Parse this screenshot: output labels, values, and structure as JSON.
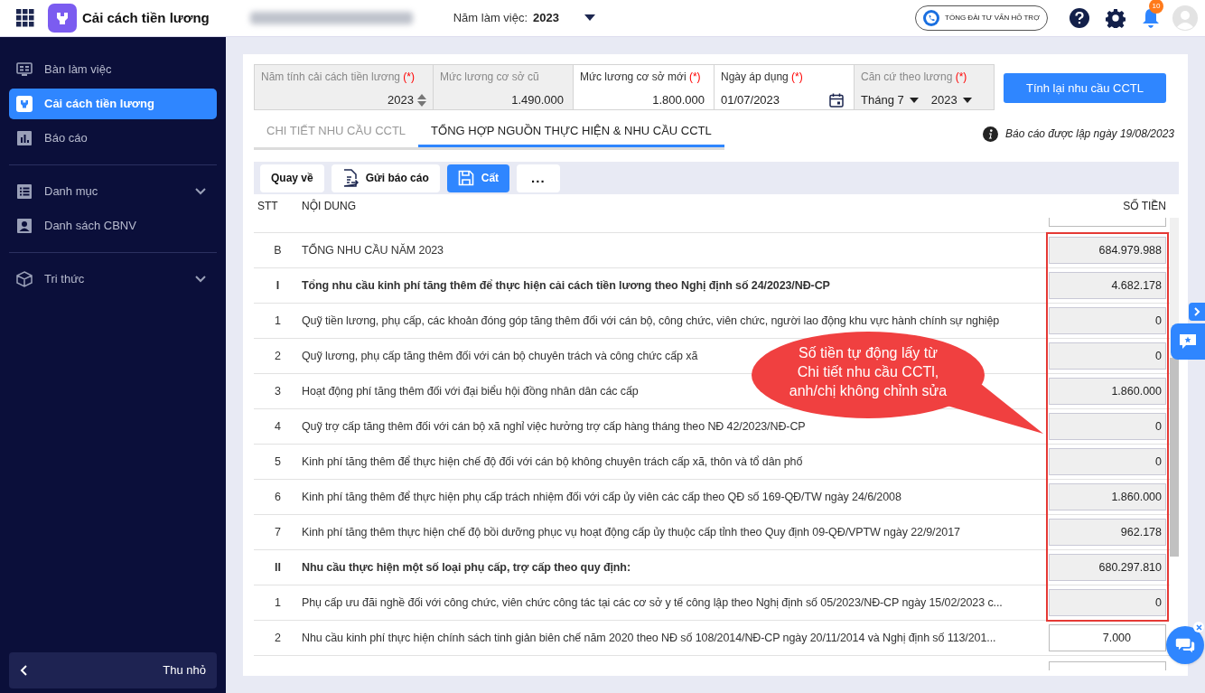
{
  "header": {
    "app_title": "Cải cách tiền lương",
    "year_label": "Năm làm việc:",
    "year": "2023",
    "hotline": "TỔNG ĐÀI TƯ VẤN HỖ TRỢ",
    "notification_count": "10"
  },
  "sidebar": {
    "sections": [
      [
        {
          "label": "Bàn làm việc",
          "selected": false,
          "has_submenu": false
        },
        {
          "label": "Cải cách tiền lương",
          "selected": true,
          "has_submenu": false
        },
        {
          "label": "Báo cáo",
          "selected": false,
          "has_submenu": false
        }
      ],
      [
        {
          "label": "Danh mục",
          "selected": false,
          "has_submenu": true
        },
        {
          "label": "Danh sách CBNV",
          "selected": false,
          "has_submenu": false
        }
      ],
      [
        {
          "label": "Tri thức",
          "selected": false,
          "has_submenu": true
        }
      ]
    ],
    "collapse_label": "Thu nhỏ"
  },
  "form": {
    "fields": [
      {
        "label": "Năm tính cải cách tiền lương",
        "required_mark": "(*)",
        "kind": "spinner",
        "disabled": true,
        "values": [
          "2023"
        ]
      },
      {
        "label": "Mức lương cơ sở cũ",
        "kind": "text",
        "disabled": true,
        "values": [
          "1.490.000"
        ]
      },
      {
        "label": "Mức lương cơ sở mới",
        "required_mark": "(*)",
        "kind": "text",
        "disabled": false,
        "values": [
          "1.800.000"
        ]
      },
      {
        "label": "Ngày áp dụng",
        "required_mark": "(*)",
        "kind": "date",
        "disabled": false,
        "values": [
          "01/07/2023"
        ]
      },
      {
        "label": "Căn cứ theo lương",
        "required_mark": "(*)",
        "kind": "selects",
        "disabled": true,
        "values": [
          "Tháng 7",
          "2023"
        ]
      }
    ],
    "button": "Tính lại nhu cầu CCTL"
  },
  "tabs": [
    {
      "label": "CHI TIẾT NHU CẦU CCTL",
      "selected": false
    },
    {
      "label": "TỔNG HỢP NGUỒN THỰC HIỆN & NHU CẦU CCTL",
      "selected": true
    }
  ],
  "report_note": "Báo cáo được lập ngày 19/08/2023",
  "toolbar": [
    {
      "label": "Quay về",
      "kind": "plain"
    },
    {
      "label": "Gửi báo cáo",
      "kind": "send"
    },
    {
      "label": "Cất",
      "kind": "save"
    },
    {
      "label": "...",
      "kind": "more"
    }
  ],
  "table": {
    "columns": [
      "STT",
      "NỘI DUNG",
      "SỐ TIỀN"
    ],
    "rows": [
      {
        "stt": "B",
        "content": "TỔNG NHU CẦU NĂM 2023",
        "amount": "684.979.988",
        "bold": false,
        "readonly": true
      },
      {
        "stt": "I",
        "content": "Tổng nhu cầu kinh phí tăng thêm để thực hiện cải cách tiền lương theo Nghị định số 24/2023/NĐ-CP",
        "amount": "4.682.178",
        "bold": true,
        "readonly": true
      },
      {
        "stt": "1",
        "content": "Quỹ tiền lương, phụ cấp, các khoản đóng góp tăng thêm đối với cán bộ, công chức, viên chức, người lao động khu vực hành chính sự nghiệp",
        "amount": "0",
        "bold": false,
        "readonly": true
      },
      {
        "stt": "2",
        "content": "Quỹ lương, phụ cấp tăng thêm đối với cán bộ chuyên trách và công chức cấp xã",
        "amount": "0",
        "bold": false,
        "readonly": true
      },
      {
        "stt": "3",
        "content": "Hoạt động phí tăng thêm đối với đại biểu hội đồng nhân dân các cấp",
        "amount": "1.860.000",
        "bold": false,
        "readonly": true
      },
      {
        "stt": "4",
        "content": "Quỹ trợ cấp tăng thêm đối với cán bộ xã nghỉ việc hưởng trợ cấp hàng tháng theo NĐ 42/2023/NĐ-CP",
        "amount": "0",
        "bold": false,
        "readonly": true
      },
      {
        "stt": "5",
        "content": "Kinh phí tăng thêm để thực hiện chế độ đối với cán bộ không chuyên trách cấp xã, thôn và tổ dân phố",
        "amount": "0",
        "bold": false,
        "readonly": true
      },
      {
        "stt": "6",
        "content": "Kinh phí tăng thêm để thực hiện phụ cấp trách nhiệm đối với cấp ủy viên các cấp theo QĐ số 169-QĐ/TW ngày 24/6/2008",
        "amount": "1.860.000",
        "bold": false,
        "readonly": true
      },
      {
        "stt": "7",
        "content": "Kinh phí tăng thêm thực hiện chế độ bồi dưỡng phục vụ hoạt động cấp ủy thuộc cấp tỉnh theo Quy định 09-QĐ/VPTW ngày 22/9/2017",
        "amount": "962.178",
        "bold": false,
        "readonly": true
      },
      {
        "stt": "II",
        "content": "Nhu cầu thực hiện một số loại phụ cấp, trợ cấp theo quy định:",
        "amount": "680.297.810",
        "bold": true,
        "readonly": true
      },
      {
        "stt": "1",
        "content": "Phụ cấp ưu đãi nghề đối với công chức, viên chức công tác tại các cơ sở y tế công lập theo Nghị định số 05/2023/NĐ-CP ngày 15/02/2023 c...",
        "amount": "0",
        "bold": false,
        "readonly": true
      },
      {
        "stt": "2",
        "content": "Nhu cầu kinh phí thực hiện chính sách tinh giản biên chế năm 2020 theo NĐ số 108/2014/NĐ-CP ngày 20/11/2014 và Nghị định số 113/201...",
        "amount": "7.000",
        "bold": false,
        "readonly": false
      }
    ]
  },
  "callout": {
    "lines": [
      "Số tiền tự động lấy từ",
      "Chi tiết nhu cầu CCTl,",
      "anh/chị không chỉnh sửa"
    ]
  }
}
